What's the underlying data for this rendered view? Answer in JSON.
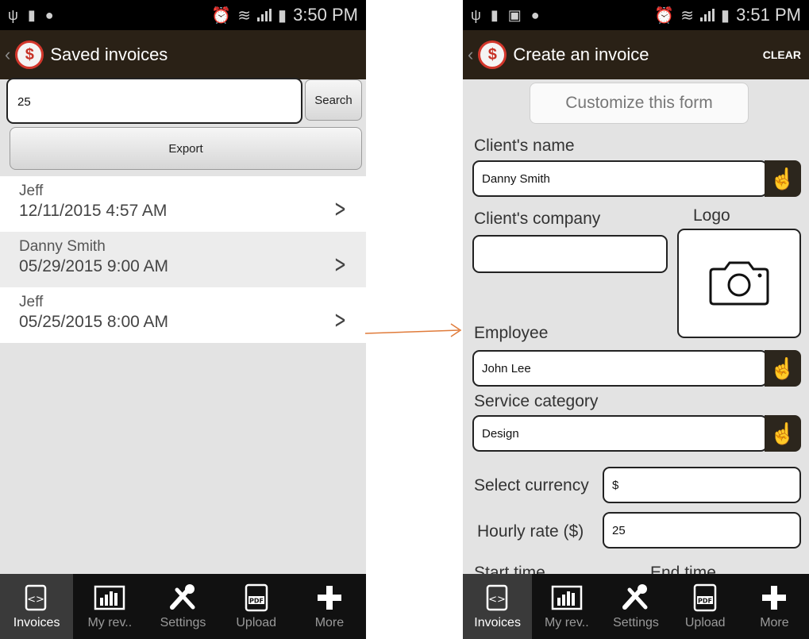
{
  "left_screen": {
    "status_bar": {
      "time": "3:50 PM"
    },
    "action_bar": {
      "title": "Saved invoices"
    },
    "search": {
      "value": "25",
      "button_label": "Search"
    },
    "export_label": "Export",
    "invoices": [
      {
        "name": "Jeff",
        "datetime": "12/11/2015 4:57 AM"
      },
      {
        "name": "Danny Smith",
        "datetime": "05/29/2015 9:00 AM"
      },
      {
        "name": "Jeff",
        "datetime": "05/25/2015 8:00 AM"
      }
    ],
    "nav": [
      "Invoices",
      "My rev..",
      "Settings",
      "Upload",
      "More"
    ]
  },
  "right_screen": {
    "status_bar": {
      "time": "3:51 PM"
    },
    "action_bar": {
      "title": "Create an invoice",
      "clear_label": "CLEAR"
    },
    "customize_label": "Customize this form",
    "fields": {
      "client_name_label": "Client's name",
      "client_name_value": "Danny Smith",
      "client_company_label": "Client's company",
      "client_company_value": "",
      "logo_label": "Logo",
      "employee_label": "Employee",
      "employee_value": "John Lee",
      "service_category_label": "Service category",
      "service_category_value": "Design",
      "currency_label": "Select currency",
      "currency_value": "$",
      "hourly_rate_label": "Hourly rate ($)",
      "hourly_rate_value": "25",
      "start_time_label": "Start time",
      "end_time_label": "End time"
    },
    "nav": [
      "Invoices",
      "My rev..",
      "Settings",
      "Upload",
      "More"
    ]
  },
  "colors": {
    "action_bar": "#2a2116",
    "connector": "#e07b3a",
    "nav_bg": "#111111"
  },
  "icons": [
    "usb-icon",
    "battery-icon",
    "chat-icon",
    "alarm-icon",
    "wifi-icon",
    "signal-icon",
    "back-chevron-icon",
    "app-logo-icon",
    "chevron-right-icon",
    "hand-pointer-icon",
    "camera-icon",
    "invoices-icon",
    "revenue-chart-icon",
    "settings-tools-icon",
    "pdf-upload-icon",
    "plus-icon"
  ]
}
